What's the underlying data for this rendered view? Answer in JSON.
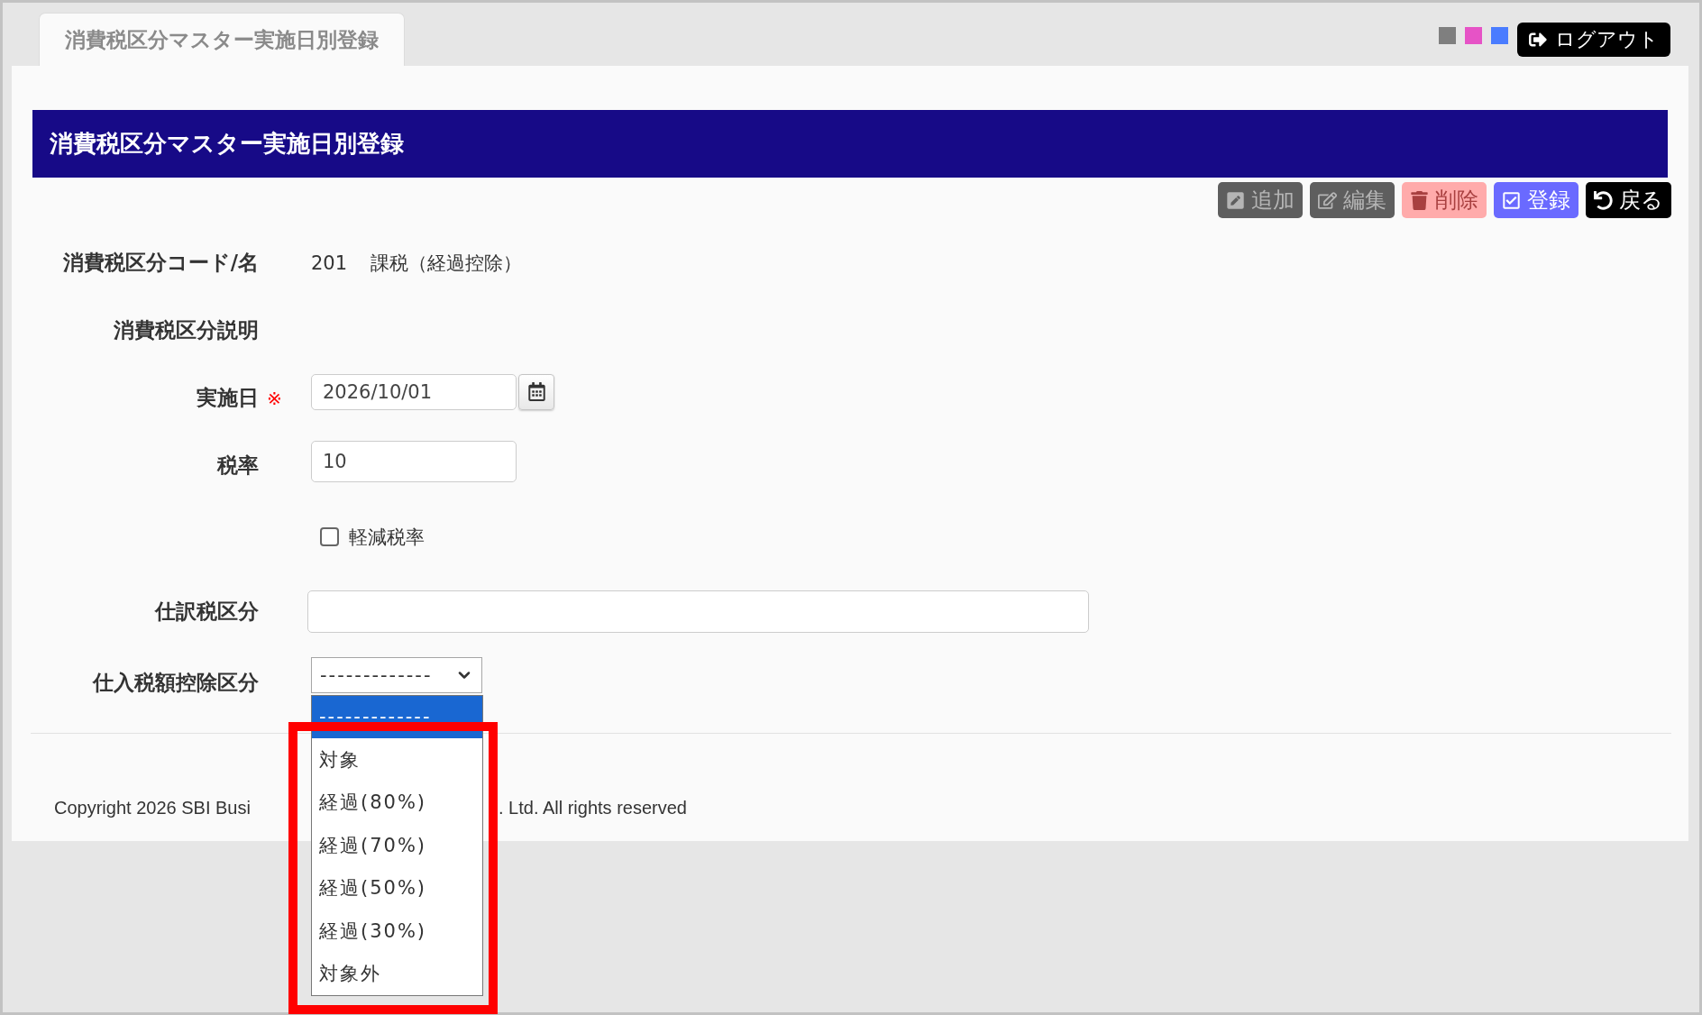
{
  "tabs": [
    {
      "label": "消費税区分マスター実施日別登録",
      "selected": true
    }
  ],
  "theme_swatches": [
    {
      "color": "#7f7f7f"
    },
    {
      "color": "#e653c6"
    },
    {
      "color": "#4a7cff"
    }
  ],
  "logout_button": {
    "label": "ログアウト"
  },
  "page_title": "消費税区分マスター実施日別登録",
  "toolbar": [
    {
      "kind": "add",
      "label": "追加",
      "disabled": true
    },
    {
      "kind": "edit",
      "label": "編集",
      "disabled": true
    },
    {
      "kind": "delete",
      "label": "削除",
      "disabled": true
    },
    {
      "kind": "register",
      "label": "登録",
      "disabled": false
    },
    {
      "kind": "back",
      "label": "戻る",
      "disabled": false
    }
  ],
  "form": {
    "fields": [
      {
        "kind": "display",
        "label": "消費税区分コード/名",
        "code": "201",
        "name": "課税（経過控除）"
      },
      {
        "kind": "display",
        "label": "消費税区分説明"
      },
      {
        "kind": "date",
        "label": "実施日",
        "required": true,
        "required_mark": "※",
        "value": "2026/10/01"
      },
      {
        "kind": "text",
        "label": "税率",
        "value": "10"
      },
      {
        "kind": "checkbox",
        "label": "軽減税率",
        "checked": false
      },
      {
        "kind": "wide",
        "label": "仕訳税区分"
      },
      {
        "kind": "select",
        "label": "仕入税額控除区分",
        "value": "-------------",
        "expanded": true,
        "options": [
          {
            "label": "-------------",
            "selected": true
          },
          {
            "label": "対象",
            "selected": false
          },
          {
            "label": "経過(80%)",
            "selected": false
          },
          {
            "label": "経過(70%)",
            "selected": false
          },
          {
            "label": "経過(50%)",
            "selected": false
          },
          {
            "label": "経過(30%)",
            "selected": false
          },
          {
            "label": "対象外",
            "selected": false
          }
        ]
      }
    ]
  },
  "footer": {
    "copyright_start": "Copyright 2026 SBI Busi",
    "copyright_end": ". Ltd. All rights reserved"
  }
}
